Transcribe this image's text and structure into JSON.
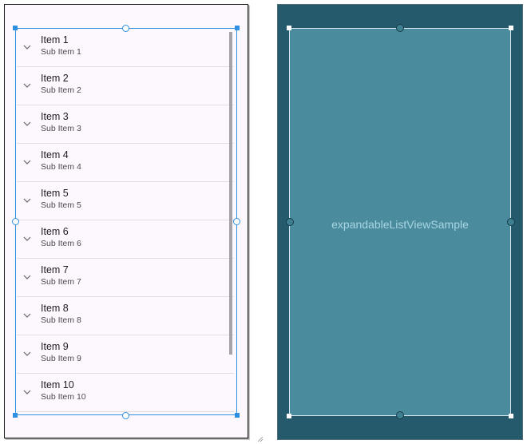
{
  "design": {
    "items": [
      {
        "title": "Item 1",
        "sub": "Sub Item 1"
      },
      {
        "title": "Item 2",
        "sub": "Sub Item 2"
      },
      {
        "title": "Item 3",
        "sub": "Sub Item 3"
      },
      {
        "title": "Item 4",
        "sub": "Sub Item 4"
      },
      {
        "title": "Item 5",
        "sub": "Sub Item 5"
      },
      {
        "title": "Item 6",
        "sub": "Sub Item 6"
      },
      {
        "title": "Item 7",
        "sub": "Sub Item 7"
      },
      {
        "title": "Item 8",
        "sub": "Sub Item 8"
      },
      {
        "title": "Item 9",
        "sub": "Sub Item 9"
      },
      {
        "title": "Item 10",
        "sub": "Sub Item 10"
      }
    ],
    "expand_icon": "chevron-down-icon"
  },
  "blueprint": {
    "label": "expandableListViewSample"
  },
  "colors": {
    "selection": "#2f8fe0",
    "design_bg": "#fdf7fe",
    "blueprint_bg": "#245a6b",
    "blueprint_view": "#4a8b9e",
    "blueprint_text": "#a9d6e3"
  }
}
